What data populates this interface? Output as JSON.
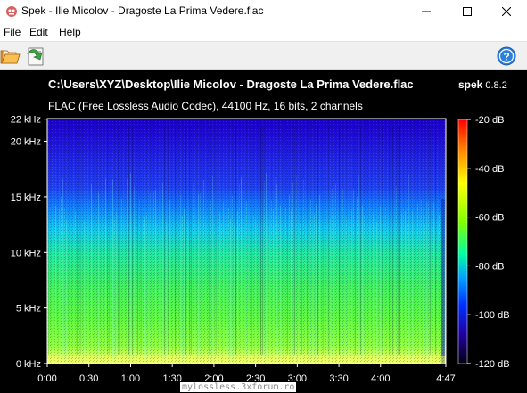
{
  "window": {
    "title": "Spek - Ilie Micolov - Dragoste La Prima Vedere.flac",
    "minimize_icon": "minimize-icon",
    "maximize_icon": "maximize-icon",
    "close_icon": "close-icon"
  },
  "menu": {
    "items": [
      "File",
      "Edit",
      "Help"
    ]
  },
  "toolbar": {
    "open_icon": "folder-open-icon",
    "save_icon": "save-icon",
    "help_icon": "help-icon"
  },
  "header": {
    "file_path": "C:\\Users\\XYZ\\Desktop\\Ilie Micolov - Dragoste La Prima Vedere.flac",
    "brand": "spek",
    "version": "0.8.2",
    "file_info": "FLAC (Free Lossless Audio Codec), 44100 Hz, 16 bits, 2 channels"
  },
  "spectrogram": {
    "freq_labels": [
      "22 kHz",
      "20 kHz",
      "15 kHz",
      "10 kHz",
      "5 kHz",
      "0 kHz"
    ],
    "freq_values_khz": [
      22,
      20,
      15,
      10,
      5,
      0
    ],
    "time_labels": [
      "0:00",
      "0:30",
      "1:00",
      "1:30",
      "2:00",
      "2:30",
      "3:00",
      "3:30",
      "4:00",
      "4:47"
    ],
    "time_values_sec": [
      0,
      30,
      60,
      90,
      120,
      150,
      180,
      210,
      240,
      287
    ],
    "duration_sec": 287,
    "max_freq_khz": 22.05
  },
  "colorbar": {
    "labels": [
      "-20 dB",
      "-40 dB",
      "-60 dB",
      "-80 dB",
      "-100 dB",
      "-120 dB"
    ],
    "values_db": [
      -20,
      -40,
      -60,
      -80,
      -100,
      -120
    ],
    "colors": [
      "#ff0000",
      "#ff8000",
      "#ffff00",
      "#80ff00",
      "#00ffa0",
      "#00a0ff",
      "#0030ff",
      "#2000a0",
      "#000010"
    ]
  },
  "status": {
    "text": "mylossless.3xforum.ro"
  }
}
